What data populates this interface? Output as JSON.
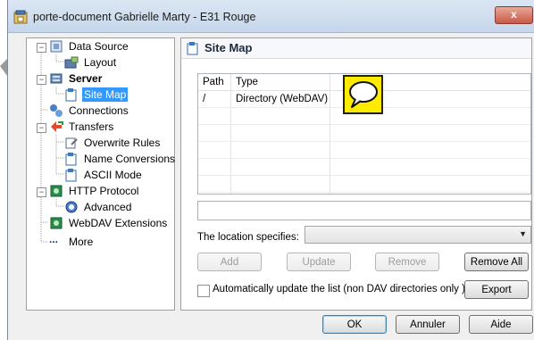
{
  "window": {
    "title": "porte-document Gabrielle Marty - E31 Rouge",
    "close_label": "x"
  },
  "tree": {
    "items": [
      {
        "label": "Data Source"
      },
      {
        "label": "Layout"
      },
      {
        "label": "Server"
      },
      {
        "label": "Site Map"
      },
      {
        "label": "Connections"
      },
      {
        "label": "Transfers"
      },
      {
        "label": "Overwrite Rules"
      },
      {
        "label": "Name Conversions"
      },
      {
        "label": "ASCII Mode"
      },
      {
        "label": "HTTP Protocol"
      },
      {
        "label": "Advanced"
      },
      {
        "label": "WebDAV Extensions"
      },
      {
        "label": "More"
      }
    ],
    "more_prefix": "..."
  },
  "panel": {
    "title": "Site Map",
    "columns": [
      "Path",
      "Type"
    ],
    "rows": [
      {
        "path": "/",
        "type": "Directory (WebDAV)"
      }
    ],
    "location_label": "The location specifies:",
    "buttons": {
      "add": "Add",
      "update": "Update",
      "remove": "Remove",
      "remove_all": "Remove All",
      "export": "Export"
    },
    "auto_update_label": "Automatically update the list (non DAV directories only )."
  },
  "footer": {
    "ok": "OK",
    "cancel": "Annuler",
    "help": "Aide"
  },
  "colors": {
    "selection": "#3399ff",
    "bubble": "#ffeb00"
  }
}
